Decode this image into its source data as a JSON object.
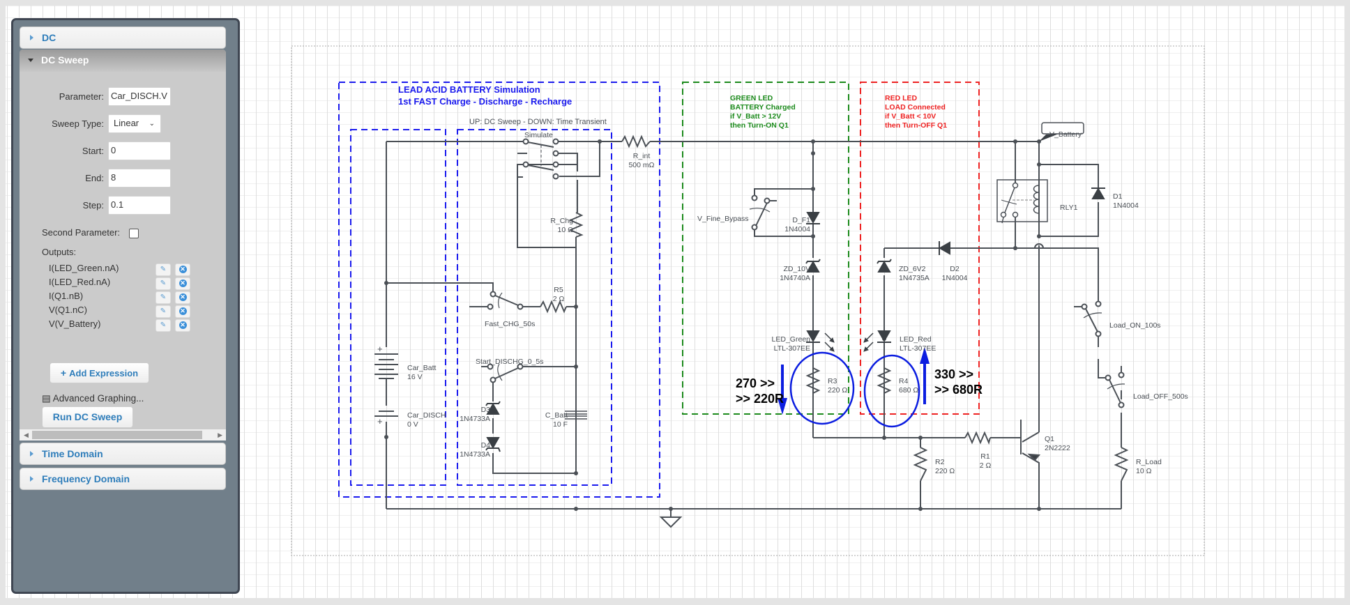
{
  "sidebar": {
    "sections": [
      {
        "label": "DC",
        "expanded": false
      },
      {
        "label": "DC Sweep",
        "expanded": true
      },
      {
        "label": "Time Domain",
        "expanded": false
      },
      {
        "label": "Frequency Domain",
        "expanded": false
      }
    ],
    "dc_sweep": {
      "parameter_label": "Parameter:",
      "parameter_value": "Car_DISCH.V",
      "sweep_type_label": "Sweep Type:",
      "sweep_type_value": "Linear",
      "start_label": "Start:",
      "start_value": "0",
      "end_label": "End:",
      "end_value": "8",
      "step_label": "Step:",
      "step_value": "0.1",
      "second_param_label": "Second Parameter:",
      "second_param_checked": false,
      "outputs_label": "Outputs:",
      "outputs": [
        "I(LED_Green.nA)",
        "I(LED_Red.nA)",
        "I(Q1.nB)",
        "V(Q1.nC)",
        "V(V_Battery)"
      ],
      "edit_icon": "✎",
      "remove_icon": "✕",
      "add_expression_label": "Add Expression",
      "add_icon": "+",
      "advanced_graphing_label": "Advanced Graphing...",
      "advanced_icon": "▤",
      "run_button_label": "Run DC Sweep"
    }
  },
  "schematic": {
    "colors": {
      "wire": "#4a4f55",
      "blue_box": "#1a1aee",
      "green_box": "#1b8a1b",
      "red_box": "#ee2222",
      "annot": "#0b1de0"
    },
    "titles": {
      "main_line1": "LEAD ACID BATTERY Simulation",
      "main_line2": "1st FAST Charge - Discharge - Recharge",
      "sim_note": "UP: DC Sweep - DOWN: Time Transient",
      "green": [
        "GREEN LED",
        "BATTERY Charged",
        "if V_Batt > 12V",
        "then Turn-ON Q1"
      ],
      "red": [
        "RED LED",
        "LOAD Connected",
        "if V_Batt < 10V",
        "then Turn-OFF Q1"
      ]
    },
    "components": {
      "simulate": "Simulate",
      "r_int": {
        "name": "R_int",
        "value": "500 mΩ"
      },
      "r_chg": {
        "name": "R_Chg",
        "value": "10 Ω"
      },
      "r5": {
        "name": "R5",
        "value": "2 Ω"
      },
      "fast_chg": "Fast_CHG_50s",
      "start_dischg": "Start_DISCHG_0_5s",
      "car_batt": {
        "name": "Car_Batt",
        "value": "16 V"
      },
      "car_disch": {
        "name": "Car_DISCH",
        "value": "0 V"
      },
      "d3": {
        "name": "D3",
        "value": "1N4733A"
      },
      "d4": {
        "name": "D4",
        "value": "1N4733A"
      },
      "c_batt": {
        "name": "C_Batt",
        "value": "10 F"
      },
      "v_fine": "V_Fine_Bypass",
      "d_f1": {
        "name": "D_F1",
        "value": "1N4004"
      },
      "zd_10v": {
        "name": "ZD_10V",
        "value": "1N4740A"
      },
      "led_green": {
        "name": "LED_Green",
        "value": "LTL-307EE"
      },
      "r3": {
        "name": "R3",
        "value": "220 Ω"
      },
      "zd_6v2": {
        "name": "ZD_6V2",
        "value": "1N4735A"
      },
      "d2": {
        "name": "D2",
        "value": "1N4004"
      },
      "led_red": {
        "name": "LED_Red",
        "value": "LTL-307EE"
      },
      "r4": {
        "name": "R4",
        "value": "680 Ω"
      },
      "v_battery": "V_Battery",
      "rly1": "RLY1",
      "d1": {
        "name": "D1",
        "value": "1N4004"
      },
      "load_on": "Load_ON_100s",
      "load_off": "Load_OFF_500s",
      "r1": {
        "name": "R1",
        "value": "2 Ω"
      },
      "r2": {
        "name": "R2",
        "value": "220 Ω"
      },
      "q1": {
        "name": "Q1",
        "value": "2N2222"
      },
      "r_load": {
        "name": "R_Load",
        "value": "10 Ω"
      }
    },
    "annotations": {
      "green_change": [
        "270 >>",
        ">> 220R"
      ],
      "red_change": [
        "330 >>",
        ">> 680R"
      ]
    }
  }
}
